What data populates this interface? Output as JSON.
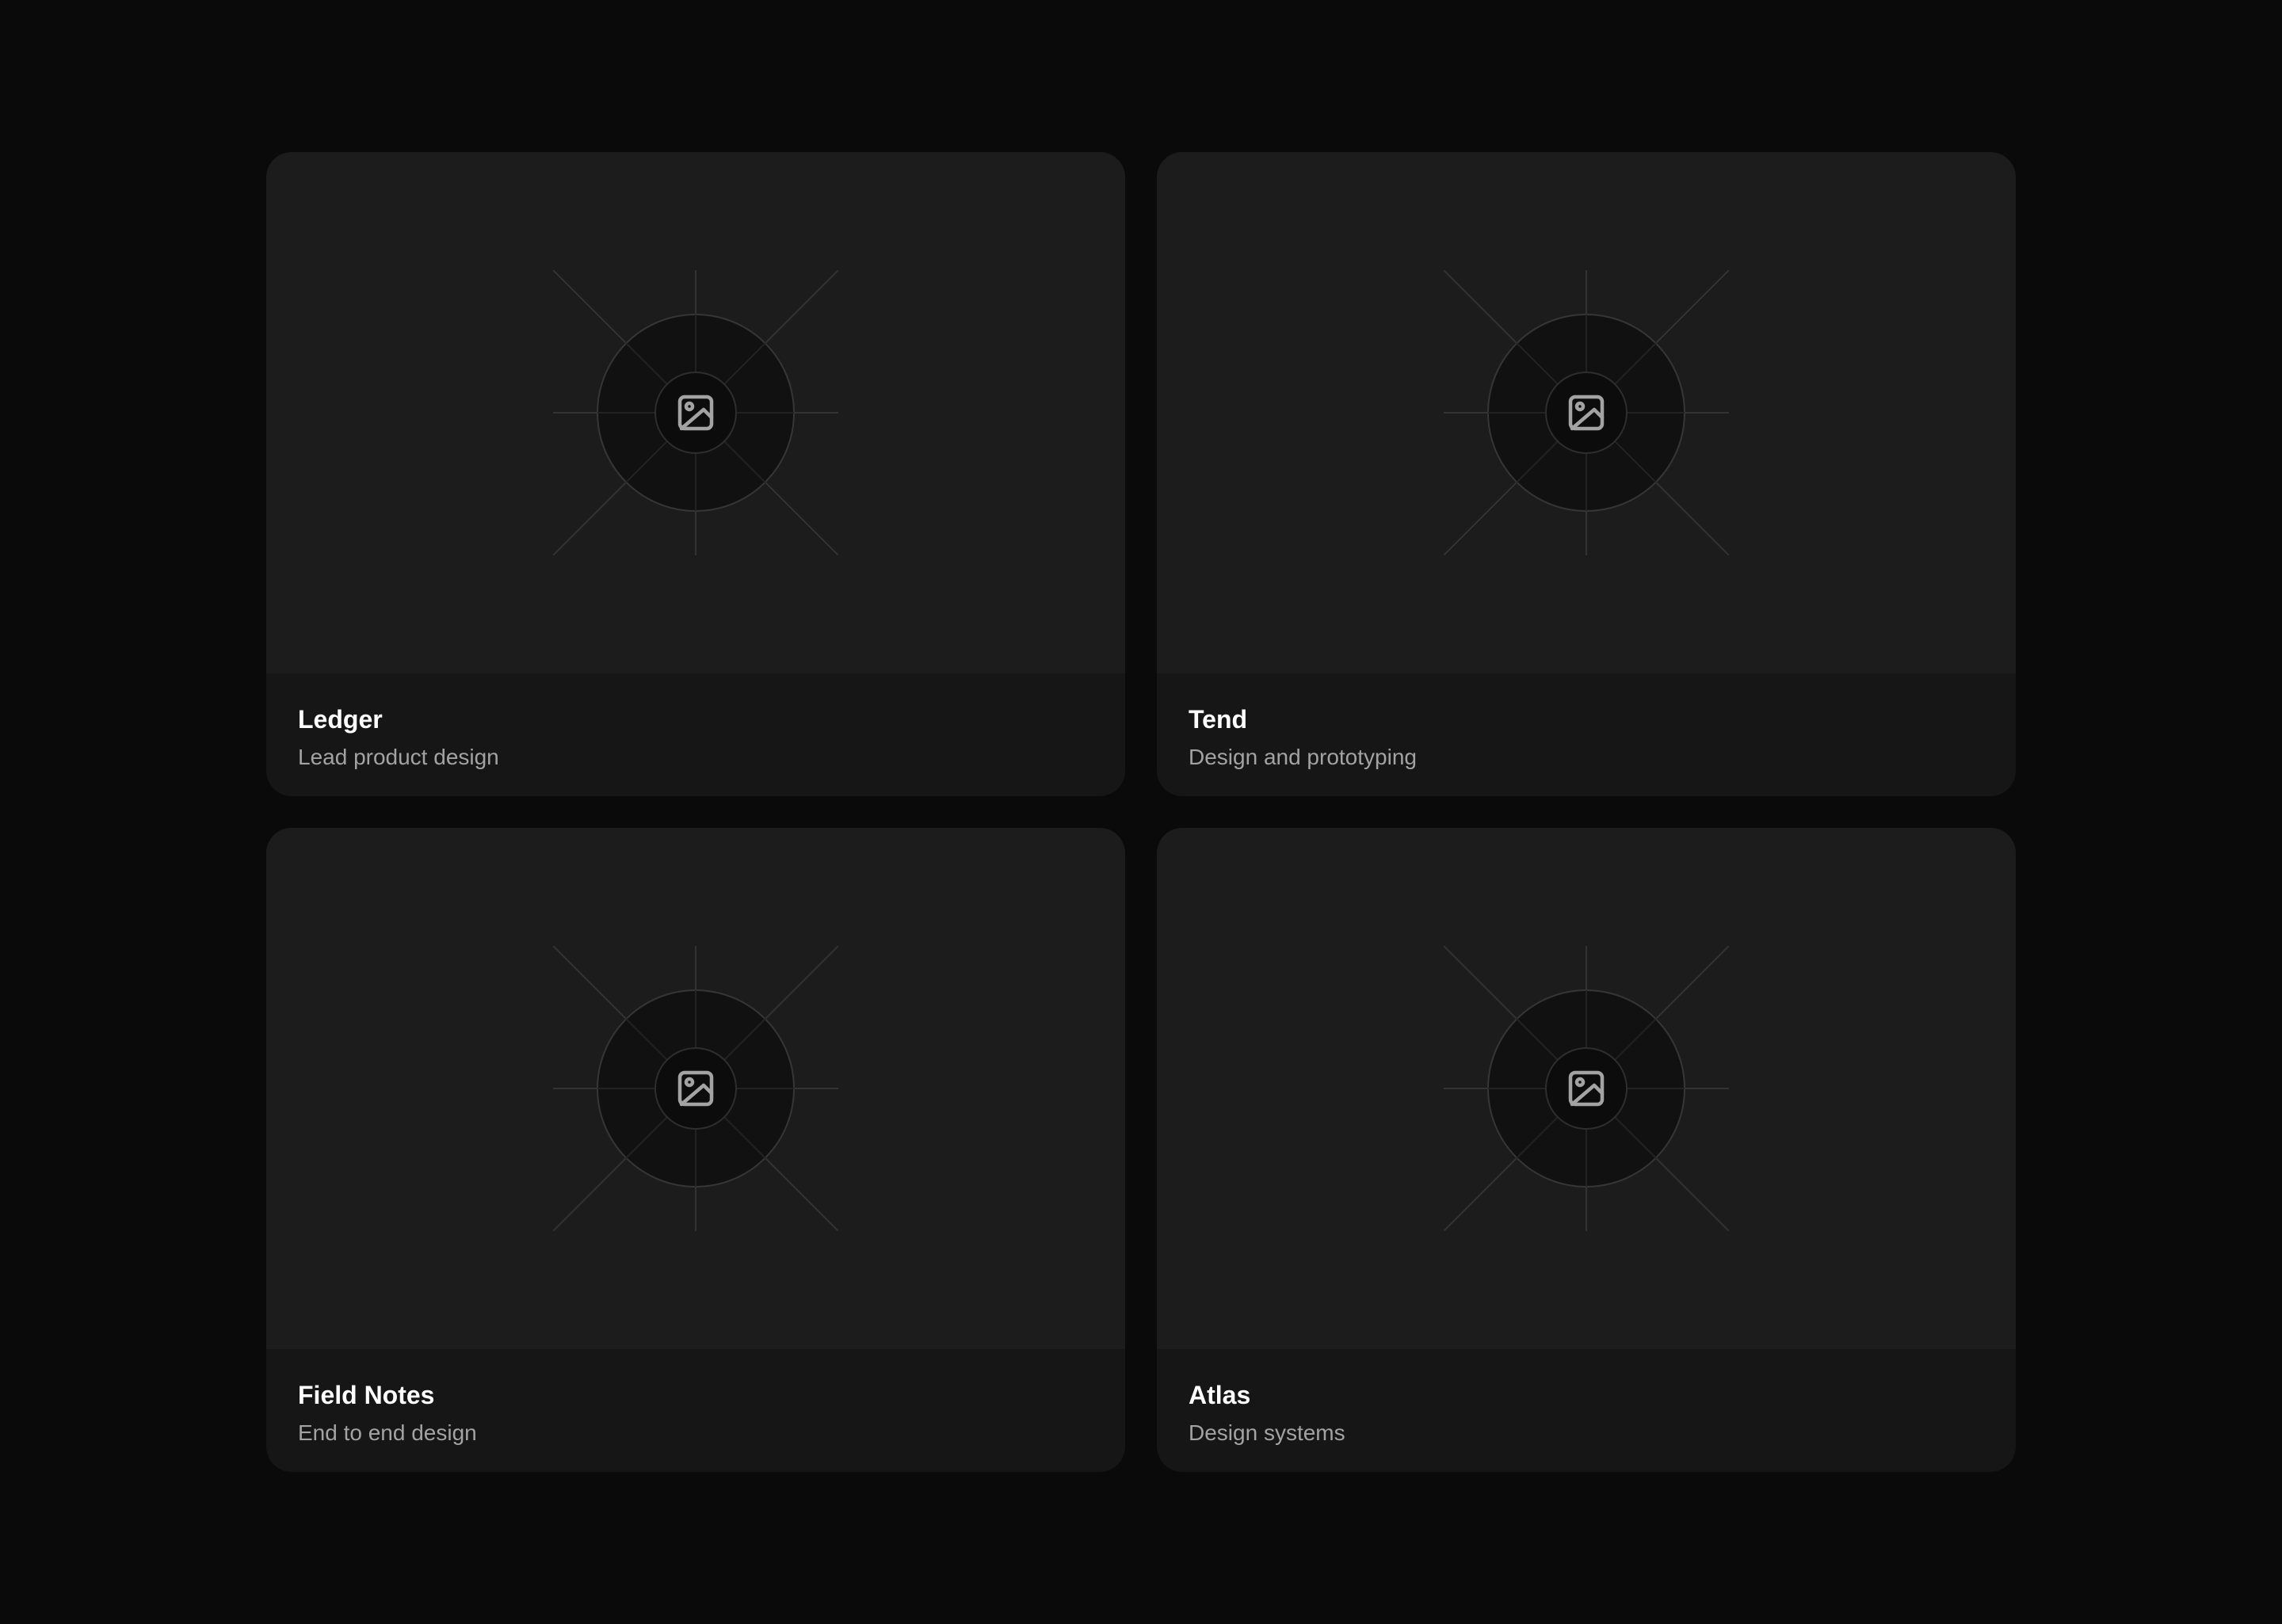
{
  "colors": {
    "page_background": "#0a0a0a",
    "card_background": "#161616",
    "thumbnail_background": "#1c1c1c",
    "title_text": "#ffffff",
    "subtitle_text": "#a3a3a3"
  },
  "projects": [
    {
      "title": "Ledger",
      "subtitle": "Lead product design",
      "icon": "image-placeholder-icon"
    },
    {
      "title": "Tend",
      "subtitle": "Design and prototyping",
      "icon": "image-placeholder-icon"
    },
    {
      "title": "Field Notes",
      "subtitle": "End to end design",
      "icon": "image-placeholder-icon"
    },
    {
      "title": "Atlas",
      "subtitle": "Design systems",
      "icon": "image-placeholder-icon"
    }
  ]
}
